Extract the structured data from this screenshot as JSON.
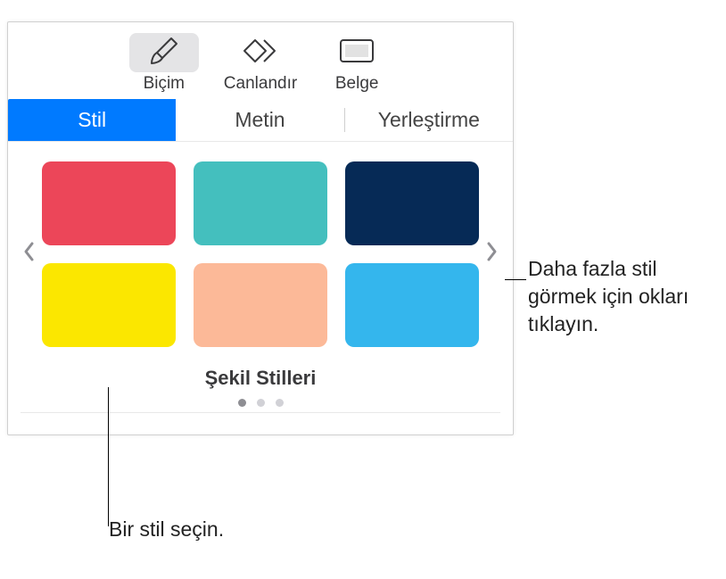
{
  "toolbar": {
    "items": [
      {
        "label": "Biçim",
        "icon": "brush"
      },
      {
        "label": "Canlandır",
        "icon": "diamonds"
      },
      {
        "label": "Belge",
        "icon": "document"
      }
    ]
  },
  "subtabs": {
    "items": [
      {
        "label": "Stil"
      },
      {
        "label": "Metin"
      },
      {
        "label": "Yerleştirme"
      }
    ]
  },
  "styles": {
    "title": "Şekil Stilleri",
    "swatches": [
      {
        "color": "#ec4659"
      },
      {
        "color": "#44bfbe"
      },
      {
        "color": "#062a56"
      },
      {
        "color": "#fbe700"
      },
      {
        "color": "#fcb998"
      },
      {
        "color": "#34b6ed"
      }
    ],
    "page_count": 3,
    "active_page": 0
  },
  "callouts": {
    "right": "Daha fazla stil görmek için okları tıklayın.",
    "bottom": "Bir stil seçin."
  }
}
